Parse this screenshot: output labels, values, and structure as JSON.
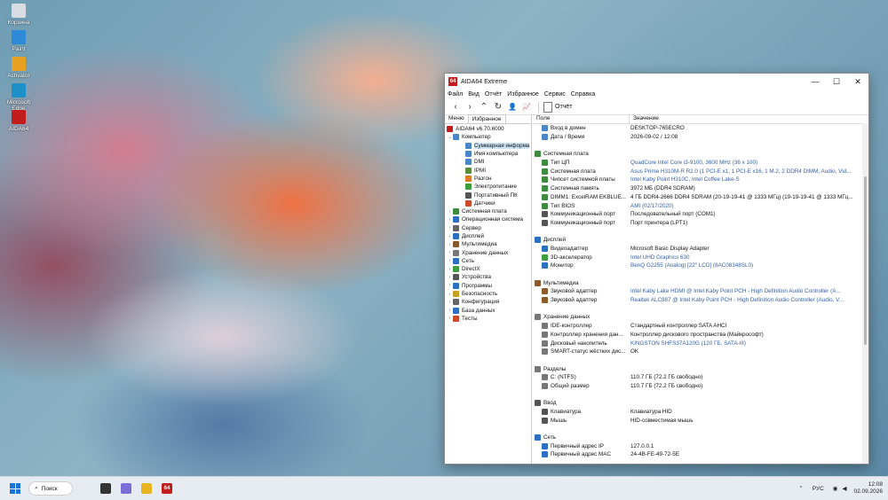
{
  "desktop": {
    "icons": [
      {
        "label": "Корзина",
        "color": "#d8dde3"
      },
      {
        "label": "Paint",
        "color": "#2d8ad6"
      },
      {
        "label": "Activator",
        "color": "#e8a020"
      },
      {
        "label": "Microsoft Edge",
        "color": "#1e90c8"
      },
      {
        "label": "AIDA64",
        "color": "#c21d1d"
      }
    ]
  },
  "window": {
    "app_icon": "64",
    "title": "AIDA64 Extreme",
    "controls": {
      "minimize": "—",
      "maximize": "☐",
      "close": "✕"
    },
    "menu": [
      "Файл",
      "Вид",
      "Отчёт",
      "Избранное",
      "Сервис",
      "Справка"
    ],
    "toolbar": {
      "back": "‹",
      "forward": "›",
      "up": "⌃",
      "refresh": "↻",
      "user": "👤",
      "chart": "📈",
      "report_label": "Отчёт"
    },
    "tabs": [
      "Меню",
      "Избранное"
    ],
    "tree": [
      {
        "label": "AIDA64 v6.70.6000",
        "level": 0,
        "arrow": "",
        "color": "#c21d1d"
      },
      {
        "label": "Компьютер",
        "level": 1,
        "arrow": "⌄",
        "color": "#4a86c8"
      },
      {
        "label": "Суммарная информа",
        "level": 2,
        "arrow": "",
        "color": "#4a86c8",
        "selected": true
      },
      {
        "label": "Имя компьютера",
        "level": 2,
        "arrow": "",
        "color": "#4a86c8"
      },
      {
        "label": "DMI",
        "level": 2,
        "arrow": "",
        "color": "#4a86c8"
      },
      {
        "label": "IPMI",
        "level": 2,
        "arrow": "",
        "color": "#5a8f3a"
      },
      {
        "label": "Разгон",
        "level": 2,
        "arrow": "",
        "color": "#e07820"
      },
      {
        "label": "Электропитание",
        "level": 2,
        "arrow": "",
        "color": "#3e9d3e"
      },
      {
        "label": "Портативный ПК",
        "level": 2,
        "arrow": "",
        "color": "#555"
      },
      {
        "label": "Датчики",
        "level": 2,
        "arrow": "",
        "color": "#d04a2a"
      },
      {
        "label": "Системная плата",
        "level": 1,
        "arrow": "›",
        "color": "#3e8a3e"
      },
      {
        "label": "Операционная система",
        "level": 1,
        "arrow": "›",
        "color": "#2d6fc4"
      },
      {
        "label": "Сервер",
        "level": 1,
        "arrow": "›",
        "color": "#666"
      },
      {
        "label": "Дисплей",
        "level": 1,
        "arrow": "›",
        "color": "#2d6fc4"
      },
      {
        "label": "Мультимедиа",
        "level": 1,
        "arrow": "›",
        "color": "#8a5a2a"
      },
      {
        "label": "Хранение данных",
        "level": 1,
        "arrow": "›",
        "color": "#777"
      },
      {
        "label": "Сеть",
        "level": 1,
        "arrow": "›",
        "color": "#2d6fc4"
      },
      {
        "label": "DirectX",
        "level": 1,
        "arrow": "›",
        "color": "#3e9d3e"
      },
      {
        "label": "Устройства",
        "level": 1,
        "arrow": "›",
        "color": "#555"
      },
      {
        "label": "Программы",
        "level": 1,
        "arrow": "›",
        "color": "#2d6fc4"
      },
      {
        "label": "Безопасность",
        "level": 1,
        "arrow": "›",
        "color": "#c8a020"
      },
      {
        "label": "Конфигурация",
        "level": 1,
        "arrow": "›",
        "color": "#666"
      },
      {
        "label": "База данных",
        "level": 1,
        "arrow": "›",
        "color": "#2d6fc4"
      },
      {
        "label": "Тесты",
        "level": 1,
        "arrow": "›",
        "color": "#d04a2a"
      }
    ],
    "columns": {
      "field": "Поле",
      "value": "Значение"
    },
    "rows": [
      {
        "field": "Вход в домен",
        "value": "DESKTOP-765ECRO",
        "color": "#4a86c8"
      },
      {
        "field": "Дата / Время",
        "value": "2026-09-02 / 12:08",
        "color": "#4a86c8"
      },
      {
        "section": true,
        "field": "",
        "value": ""
      },
      {
        "section": true,
        "field": "Системная плата",
        "value": "",
        "color": "#3e8a3e"
      },
      {
        "field": "Тип ЦП",
        "value": "QuadCore Intel Core i3-9100, 3600 MHz (36 x 100)",
        "link": true,
        "color": "#3e8a3e"
      },
      {
        "field": "Системная плата",
        "value": "Asus Prime H310M-R R2.0  (1 PCI-E x1, 1 PCI-E x16, 1 M.2, 2 DDR4 DIMM, Audio, Vid...",
        "link": true,
        "color": "#3e8a3e"
      },
      {
        "field": "Чипсет системной платы",
        "value": "Intel Kaby Point H310C, Intel Coffee Lake-S",
        "link": true,
        "color": "#3e8a3e"
      },
      {
        "field": "Системная память",
        "value": "3972 МБ  (DDR4 SDRAM)",
        "color": "#3e8a3e"
      },
      {
        "field": "DIMM1: ExcelRAM EKBLUE...",
        "value": "4 ГБ DDR4-2666 DDR4 SDRAM  (20-19-19-41 @ 1333 МГц)  (19-19-19-41 @ 1333 МГц...",
        "color": "#3e8a3e"
      },
      {
        "field": "Тип BIOS",
        "value": "AMI (02/17/2020)",
        "link": true,
        "color": "#3e8a3e"
      },
      {
        "field": "Коммуникационный порт",
        "value": "Последовательный порт (COM1)",
        "color": "#555"
      },
      {
        "field": "Коммуникационный порт",
        "value": "Порт принтера (LPT1)",
        "color": "#555"
      },
      {
        "section": true,
        "field": "",
        "value": ""
      },
      {
        "section": true,
        "field": "Дисплей",
        "value": "",
        "color": "#2d6fc4"
      },
      {
        "field": "Видеоадаптер",
        "value": "Microsoft Basic Display Adapter",
        "color": "#2d6fc4"
      },
      {
        "field": "3D-акселератор",
        "value": "Intel UHD Graphics 630",
        "link": true,
        "color": "#3e9d3e"
      },
      {
        "field": "Монитор",
        "value": "BenQ G2255 (Analog)  [22\" LCD]  (8AC08348SL0)",
        "link": true,
        "color": "#2d6fc4"
      },
      {
        "section": true,
        "field": "",
        "value": ""
      },
      {
        "section": true,
        "field": "Мультимедиа",
        "value": "",
        "color": "#8a5a2a"
      },
      {
        "field": "Звуковой адаптер",
        "value": "Intel Kaby Lake HDMI @ Intel Kaby Point PCH - High Definition Audio Controller (A...",
        "link": true,
        "color": "#8a5a2a"
      },
      {
        "field": "Звуковой адаптер",
        "value": "Realtek ALC887 @ Intel Kaby Point PCH - High Definition Audio Controller (Audio, V...",
        "link": true,
        "color": "#8a5a2a"
      },
      {
        "section": true,
        "field": "",
        "value": ""
      },
      {
        "section": true,
        "field": "Хранение данных",
        "value": "",
        "color": "#777"
      },
      {
        "field": "IDE-контроллер",
        "value": "Стандартный контроллер SATA AHCI",
        "color": "#777"
      },
      {
        "field": "Контроллер хранения дан...",
        "value": "Контроллер дискового пространства (Майкрософт)",
        "color": "#777"
      },
      {
        "field": "Дисковый накопитель",
        "value": "KINGSTON SHFS37A120G  (120 ГБ, SATA-III)",
        "link": true,
        "color": "#777"
      },
      {
        "field": "SMART-статус жёстких дис...",
        "value": "OK",
        "color": "#777"
      },
      {
        "section": true,
        "field": "",
        "value": ""
      },
      {
        "section": true,
        "field": "Разделы",
        "value": "",
        "color": "#777"
      },
      {
        "field": "C: (NTFS)",
        "value": "110.7 ГБ (72.2 ГБ свободно)",
        "color": "#777"
      },
      {
        "field": "Общий размер",
        "value": "110.7 ГБ (72.2 ГБ свободно)",
        "color": "#777"
      },
      {
        "section": true,
        "field": "",
        "value": ""
      },
      {
        "section": true,
        "field": "Ввод",
        "value": "",
        "color": "#555"
      },
      {
        "field": "Клавиатура",
        "value": "Клавиатура HID",
        "color": "#555"
      },
      {
        "field": "Мышь",
        "value": "HID-совместимая мышь",
        "color": "#555"
      },
      {
        "section": true,
        "field": "",
        "value": ""
      },
      {
        "section": true,
        "field": "Сеть",
        "value": "",
        "color": "#2d6fc4"
      },
      {
        "field": "Первичный адрес IP",
        "value": "127.0.0.1",
        "color": "#2d6fc4"
      },
      {
        "field": "Первичный адрес MAC",
        "value": "24-4B-FE-49-72-5E",
        "color": "#2d6fc4"
      }
    ]
  },
  "taskbar": {
    "search_label": "Поиск",
    "pinned": [
      {
        "name": "task-view",
        "color": "#333"
      },
      {
        "name": "copilot",
        "color": "#7b6cd8"
      },
      {
        "name": "file-explorer",
        "color": "#e8b420"
      },
      {
        "name": "aida64",
        "color": "#c21d1d"
      }
    ],
    "tray": {
      "chevron": "⌃",
      "language": "РУС",
      "time": "12:08",
      "date": "02.09.2026"
    }
  }
}
